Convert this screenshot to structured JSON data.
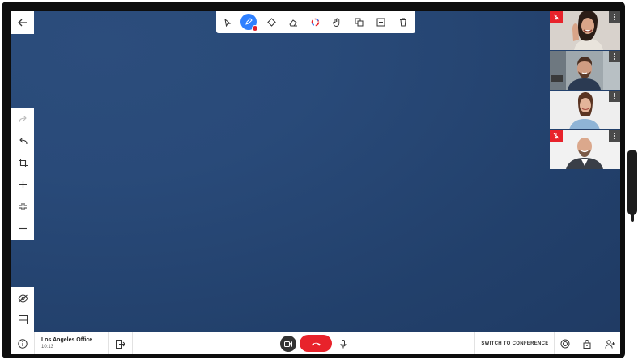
{
  "call": {
    "location": "Los Angeles Office",
    "time": "10:13",
    "switch_label": "SWITCH TO CONFERENCE"
  },
  "colors": {
    "canvas": "#284878",
    "accent": "#2f80ff",
    "danger": "#e8232b"
  },
  "toolbar": {
    "items": [
      "select-icon",
      "pen-icon",
      "shape-icon",
      "eraser-icon",
      "color-icon",
      "hand-icon",
      "duplicate-icon",
      "insert-icon",
      "delete-icon"
    ],
    "active": "pen-icon"
  },
  "left_tools": [
    "redo-icon",
    "undo-icon",
    "crop-icon",
    "zoom-in-icon",
    "fit-icon",
    "zoom-out-icon"
  ],
  "left_tools_bottom": [
    "hide-icon",
    "layout-icon"
  ],
  "participants": [
    {
      "muted": true
    },
    {
      "muted": false
    },
    {
      "muted": false
    },
    {
      "muted": true
    }
  ]
}
